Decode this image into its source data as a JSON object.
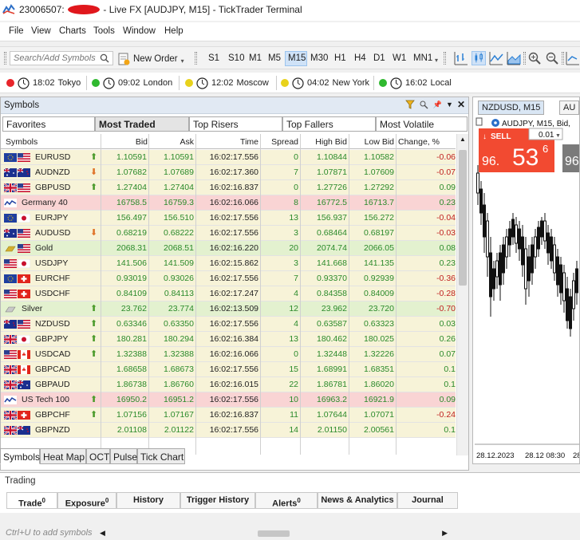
{
  "window": {
    "account": "23006507:",
    "title_tail": "- Live FX [AUDJPY, M15] - TickTrader Terminal"
  },
  "menu": [
    "File",
    "View",
    "Charts",
    "Tools",
    "Window",
    "Help"
  ],
  "toolbar": {
    "search_placeholder": "Search/Add Symbols",
    "new_order": "New Order",
    "timeframes": [
      "S1",
      "S10",
      "M1",
      "M5",
      "M15",
      "M30",
      "H1",
      "H4",
      "D1",
      "W1",
      "MN1"
    ],
    "active_timeframe": "M15"
  },
  "clocks": [
    {
      "time": "18:02",
      "city": "Tokyo",
      "color": "#e8252b"
    },
    {
      "time": "09:02",
      "city": "London",
      "color": "#2fb82f"
    },
    {
      "time": "12:02",
      "city": "Moscow",
      "color": "#e8d21c"
    },
    {
      "time": "04:02",
      "city": "New York",
      "color": "#e8d21c"
    },
    {
      "time": "16:02",
      "city": "Local",
      "color": "#2fb82f"
    }
  ],
  "symbols_panel": {
    "title": "Symbols",
    "tabs": [
      "Favorites",
      "Most Traded",
      "Top Risers",
      "Top Fallers",
      "Most Volatile"
    ],
    "active_tab": "Most Traded",
    "columns": [
      "Symbols",
      "Bid",
      "Ask",
      "Time",
      "Spread",
      "High Bid",
      "Low Bid",
      "Change, %"
    ],
    "rows": [
      {
        "symbol": "EURUSD",
        "bid": "1.10591",
        "ask": "1.10591",
        "time": "16:02:17.556",
        "spread": "0",
        "high": "1.10844",
        "low": "1.10582",
        "change": "-0.06",
        "dir": "up",
        "flag1": "eu",
        "flag2": "us",
        "bg": "#f7f3d8"
      },
      {
        "symbol": "AUDNZD",
        "bid": "1.07682",
        "ask": "1.07689",
        "time": "16:02:17.360",
        "spread": "7",
        "high": "1.07871",
        "low": "1.07609",
        "change": "-0.07",
        "dir": "down",
        "flag1": "au",
        "flag2": "nz",
        "bg": "#f7f3d8"
      },
      {
        "symbol": "GBPUSD",
        "bid": "1.27404",
        "ask": "1.27404",
        "time": "16:02:16.837",
        "spread": "0",
        "high": "1.27726",
        "low": "1.27292",
        "change": "0.09",
        "dir": "up",
        "flag1": "gb",
        "flag2": "us",
        "bg": "#f7f3d8"
      },
      {
        "symbol": "Germany 40",
        "bid": "16758.5",
        "ask": "16759.3",
        "time": "16:02:16.066",
        "spread": "8",
        "high": "16772.5",
        "low": "16713.7",
        "change": "0.23",
        "dir": "",
        "flag1": "idx",
        "flag2": "",
        "bg": "#f9d4d4"
      },
      {
        "symbol": "EURJPY",
        "bid": "156.497",
        "ask": "156.510",
        "time": "16:02:17.556",
        "spread": "13",
        "high": "156.937",
        "low": "156.272",
        "change": "-0.04",
        "dir": "",
        "flag1": "eu",
        "flag2": "jp",
        "bg": "#f7f3d8"
      },
      {
        "symbol": "AUDUSD",
        "bid": "0.68219",
        "ask": "0.68222",
        "time": "16:02:17.556",
        "spread": "3",
        "high": "0.68464",
        "low": "0.68197",
        "change": "-0.03",
        "dir": "down",
        "flag1": "au",
        "flag2": "us",
        "bg": "#f7f3d8"
      },
      {
        "symbol": "Gold",
        "bid": "2068.31",
        "ask": "2068.51",
        "time": "16:02:16.220",
        "spread": "20",
        "high": "2074.74",
        "low": "2066.05",
        "change": "0.08",
        "dir": "",
        "flag1": "gold",
        "flag2": "us",
        "bg": "#e3f1cf"
      },
      {
        "symbol": "USDJPY",
        "bid": "141.506",
        "ask": "141.509",
        "time": "16:02:15.862",
        "spread": "3",
        "high": "141.668",
        "low": "141.135",
        "change": "0.23",
        "dir": "",
        "flag1": "us",
        "flag2": "jp",
        "bg": "#f7f3d8"
      },
      {
        "symbol": "EURCHF",
        "bid": "0.93019",
        "ask": "0.93026",
        "time": "16:02:17.556",
        "spread": "7",
        "high": "0.93370",
        "low": "0.92939",
        "change": "-0.36",
        "dir": "",
        "flag1": "eu",
        "flag2": "ch",
        "bg": "#f7f3d8"
      },
      {
        "symbol": "USDCHF",
        "bid": "0.84109",
        "ask": "0.84113",
        "time": "16:02:17.247",
        "spread": "4",
        "high": "0.84358",
        "low": "0.84009",
        "change": "-0.28",
        "dir": "",
        "flag1": "us",
        "flag2": "ch",
        "bg": "#f7f3d8"
      },
      {
        "symbol": "Silver",
        "bid": "23.762",
        "ask": "23.774",
        "time": "16:02:13.509",
        "spread": "12",
        "high": "23.962",
        "low": "23.720",
        "change": "-0.70",
        "dir": "up",
        "flag1": "silver",
        "flag2": "",
        "bg": "#e3f1cf"
      },
      {
        "symbol": "NZDUSD",
        "bid": "0.63346",
        "ask": "0.63350",
        "time": "16:02:17.556",
        "spread": "4",
        "high": "0.63587",
        "low": "0.63323",
        "change": "0.03",
        "dir": "up",
        "flag1": "nz",
        "flag2": "us",
        "bg": "#f7f3d8"
      },
      {
        "symbol": "GBPJPY",
        "bid": "180.281",
        "ask": "180.294",
        "time": "16:02:16.384",
        "spread": "13",
        "high": "180.462",
        "low": "180.025",
        "change": "0.26",
        "dir": "up",
        "flag1": "gb",
        "flag2": "jp",
        "bg": "#f7f3d8"
      },
      {
        "symbol": "USDCAD",
        "bid": "1.32388",
        "ask": "1.32388",
        "time": "16:02:16.066",
        "spread": "0",
        "high": "1.32448",
        "low": "1.32226",
        "change": "0.07",
        "dir": "up",
        "flag1": "us",
        "flag2": "ca",
        "bg": "#f7f3d8"
      },
      {
        "symbol": "GBPCAD",
        "bid": "1.68658",
        "ask": "1.68673",
        "time": "16:02:17.556",
        "spread": "15",
        "high": "1.68991",
        "low": "1.68351",
        "change": "0.1",
        "dir": "",
        "flag1": "gb",
        "flag2": "ca",
        "bg": "#f7f3d8"
      },
      {
        "symbol": "GBPAUD",
        "bid": "1.86738",
        "ask": "1.86760",
        "time": "16:02:16.015",
        "spread": "22",
        "high": "1.86781",
        "low": "1.86020",
        "change": "0.1",
        "dir": "",
        "flag1": "gb",
        "flag2": "au",
        "bg": "#f7f3d8"
      },
      {
        "symbol": "US Tech 100",
        "bid": "16950.2",
        "ask": "16951.2",
        "time": "16:02:17.556",
        "spread": "10",
        "high": "16963.2",
        "low": "16921.9",
        "change": "0.09",
        "dir": "up",
        "flag1": "idx",
        "flag2": "",
        "bg": "#f9d4d4"
      },
      {
        "symbol": "GBPCHF",
        "bid": "1.07156",
        "ask": "1.07167",
        "time": "16:02:16.837",
        "spread": "11",
        "high": "1.07644",
        "low": "1.07071",
        "change": "-0.24",
        "dir": "up",
        "flag1": "gb",
        "flag2": "ch",
        "bg": "#f7f3d8"
      },
      {
        "symbol": "GBPNZD",
        "bid": "2.01108",
        "ask": "2.01122",
        "time": "16:02:17.556",
        "spread": "14",
        "high": "2.01150",
        "low": "2.00561",
        "change": "0.1",
        "dir": "",
        "flag1": "gb",
        "flag2": "nz",
        "bg": "#f7f3d8"
      }
    ],
    "hint": "Ctrl+U to add symbols"
  },
  "bottom_tabs": [
    "Symbols",
    "Heat Map",
    "OCT",
    "Pulse",
    "Tick Chart"
  ],
  "chart": {
    "tab": "NZDUSD, M15",
    "tab2": "AU",
    "header": "AUDJPY, M15, Bid,",
    "sell_label": "SELL",
    "price_big": "53",
    "price_prefix": "96.",
    "price_sup": "6",
    "lot": "0.01",
    "buy_prefix": "96",
    "dates": [
      "28.12.2023",
      "28.12 08:30",
      "28"
    ]
  },
  "trading": {
    "title": "Trading",
    "tabs": [
      {
        "label": "Trade",
        "count": "0"
      },
      {
        "label": "Exposure",
        "count": "0"
      },
      {
        "label": "History",
        "count": ""
      },
      {
        "label": "Trigger History",
        "count": ""
      },
      {
        "label": "Alerts",
        "count": "0"
      },
      {
        "label": "News & Analytics",
        "count": ""
      },
      {
        "label": "Journal",
        "count": ""
      }
    ]
  }
}
